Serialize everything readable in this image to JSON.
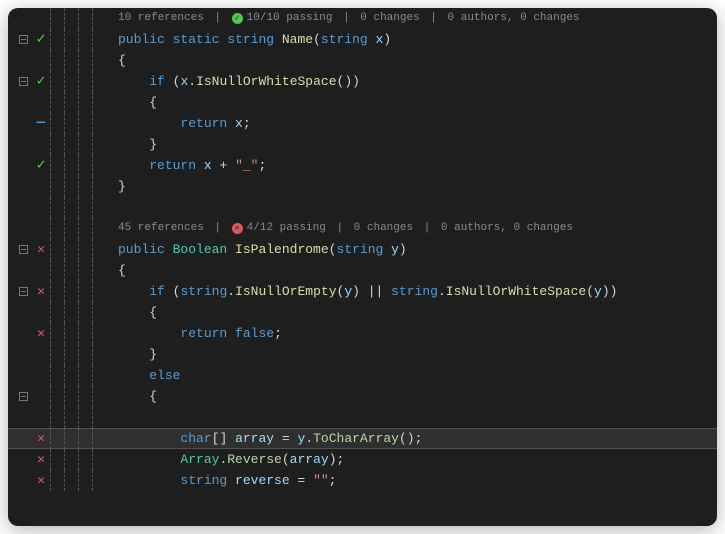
{
  "codelens1": {
    "references": "10 references",
    "tests": "10/10 passing",
    "changes": "0 changes",
    "authors": "0 authors, 0 changes"
  },
  "codelens2": {
    "references": "45 references",
    "tests": "4/12 passing",
    "changes": "0 changes",
    "authors": "0 authors, 0 changes"
  },
  "tokens": {
    "public": "public",
    "static": "static",
    "string_kw": "string",
    "Boolean": "Boolean",
    "Name": "Name",
    "IsPalendrome": "IsPalendrome",
    "IsNullOrWhiteSpace": "IsNullOrWhiteSpace",
    "IsNullOrEmpty": "IsNullOrEmpty",
    "ToCharArray": "ToCharArray",
    "Reverse": "Reverse",
    "Array": "Array",
    "char": "char",
    "if": "if",
    "else": "else",
    "return": "return",
    "false": "false",
    "x": "x",
    "y": "y",
    "array": "array",
    "reverse": "reverse",
    "underscore_str": "\"_\"",
    "empty_str": "\"\"",
    "lparen": "(",
    "rparen": ")",
    "lbrace": "{",
    "rbrace": "}",
    "lbracket": "[",
    "rbracket": "]",
    "dot": ".",
    "semi": ";",
    "plus": " + ",
    "or": " || ",
    "eq": " = ",
    "sep": " | "
  }
}
